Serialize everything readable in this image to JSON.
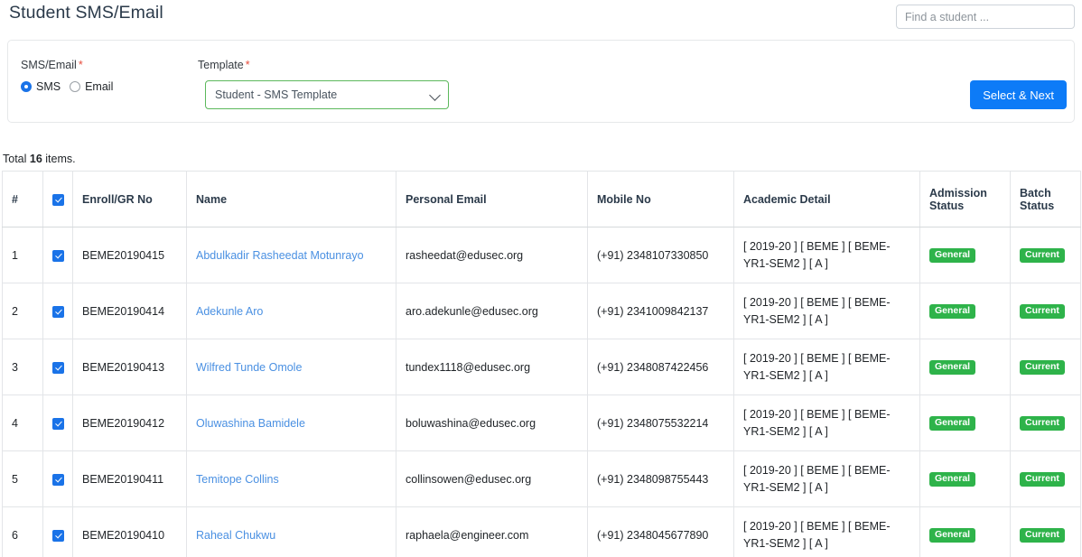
{
  "header": {
    "title": "Student SMS/Email",
    "search_placeholder": "Find a student ...",
    "search_value": ""
  },
  "filter_card": {
    "smsemail_label": "SMS/Email",
    "template_label": "Template",
    "required_mark": "*",
    "radio_options": [
      {
        "label": "SMS",
        "selected": true
      },
      {
        "label": "Email",
        "selected": false
      }
    ],
    "template_selected": "Student - SMS Template",
    "submit_label": "Select & Next"
  },
  "summary": {
    "prefix": "Total ",
    "count": "16",
    "suffix": " items."
  },
  "table": {
    "headers": {
      "num": "#",
      "select_all": "",
      "enroll": "Enroll/GR No",
      "name": "Name",
      "email": "Personal Email",
      "mobile": "Mobile No",
      "academic": "Academic Detail",
      "admission": "Admission Status",
      "batch": "Batch Status"
    },
    "select_all_checked": true,
    "rows": [
      {
        "num": "1",
        "checked": true,
        "enroll": "BEME20190415",
        "name": "Abdulkadir Rasheedat Motunrayo",
        "email": "rasheedat@edusec.org",
        "mobile": "(+91) 2348107330850",
        "academic": "[ 2019-20 ] [ BEME ] [ BEME-YR1-SEM2 ] [ A ]",
        "admission": "General",
        "batch": "Current"
      },
      {
        "num": "2",
        "checked": true,
        "enroll": "BEME20190414",
        "name": "Adekunle Aro",
        "email": "aro.adekunle@edusec.org",
        "mobile": "(+91) 2341009842137",
        "academic": "[ 2019-20 ] [ BEME ] [ BEME-YR1-SEM2 ] [ A ]",
        "admission": "General",
        "batch": "Current"
      },
      {
        "num": "3",
        "checked": true,
        "enroll": "BEME20190413",
        "name": "Wilfred Tunde Omole",
        "email": "tundex1118@edusec.org",
        "mobile": "(+91) 2348087422456",
        "academic": "[ 2019-20 ] [ BEME ] [ BEME-YR1-SEM2 ] [ A ]",
        "admission": "General",
        "batch": "Current"
      },
      {
        "num": "4",
        "checked": true,
        "enroll": "BEME20190412",
        "name": "Oluwashina Bamidele",
        "email": "boluwashina@edusec.org",
        "mobile": "(+91) 2348075532214",
        "academic": "[ 2019-20 ] [ BEME ] [ BEME-YR1-SEM2 ] [ A ]",
        "admission": "General",
        "batch": "Current"
      },
      {
        "num": "5",
        "checked": true,
        "enroll": "BEME20190411",
        "name": "Temitope Collins",
        "email": "collinsowen@edusec.org",
        "mobile": "(+91) 2348098755443",
        "academic": "[ 2019-20 ] [ BEME ] [ BEME-YR1-SEM2 ] [ A ]",
        "admission": "General",
        "batch": "Current"
      },
      {
        "num": "6",
        "checked": true,
        "enroll": "BEME20190410",
        "name": "Raheal Chukwu",
        "email": "raphaela@engineer.com",
        "mobile": "(+91) 2348045677890",
        "academic": "[ 2019-20 ] [ BEME ] [ BEME-YR1-SEM2 ] [ A ]",
        "admission": "General",
        "batch": "Current"
      }
    ]
  },
  "colors": {
    "primary_button": "#0d7bf7",
    "badge_green": "#2eb34a",
    "link_blue": "#4a90e2",
    "required_red": "#e74c3c",
    "select_border_green": "#5cb85c"
  }
}
